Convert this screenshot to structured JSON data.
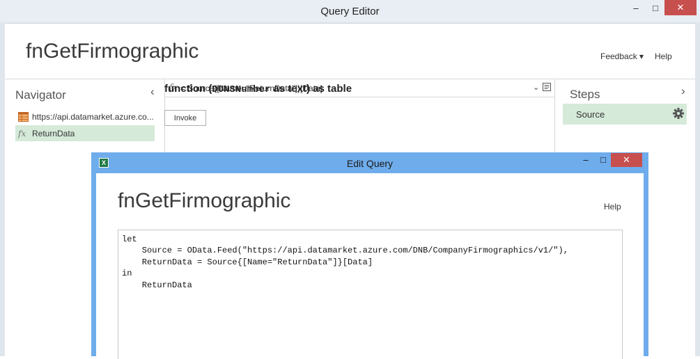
{
  "window": {
    "title": "Query Editor",
    "minimize_glyph": "‒",
    "maximize_glyph": "□",
    "close_glyph": "✕"
  },
  "header": {
    "title": "fnGetFirmographic",
    "feedback_label": "Feedback ▾",
    "help_label": "Help"
  },
  "navigator": {
    "title": "Navigator",
    "collapse_glyph": "‹",
    "items": [
      {
        "label": "https://api.datamarket.azure.co...",
        "icon": "table-icon"
      },
      {
        "label": "ReturnData",
        "icon": "function-icon",
        "icon_glyph": "fx"
      }
    ]
  },
  "formula_bar": {
    "fx": "fx",
    "text": "= Source{[Name=\"ReturnData\"]}[Data]",
    "expand_glyph": "⌄"
  },
  "function_sig": {
    "prefix": "function (",
    "param": "DUNSNumber",
    "suffix": " as text) as table"
  },
  "invoke_label": "Invoke",
  "steps": {
    "title": "Steps",
    "expand_glyph": "›",
    "items": [
      {
        "label": "Source"
      }
    ]
  },
  "dialog": {
    "title": "Edit Query",
    "app_title": "fnGetFirmographic",
    "help_label": "Help",
    "minimize_glyph": "‒",
    "maximize_glyph": "□",
    "close_glyph": "✕",
    "code": "let\n    Source = OData.Feed(\"https://api.datamarket.azure.com/DNB/CompanyFirmographics/v1/\"),\n    ReturnData = Source{[Name=\"ReturnData\"]}[Data]\nin\n    ReturnData"
  },
  "colors": {
    "accent_green": "#d5ead9",
    "dialog_frame": "#6faceb",
    "close_red": "#c7504e"
  }
}
